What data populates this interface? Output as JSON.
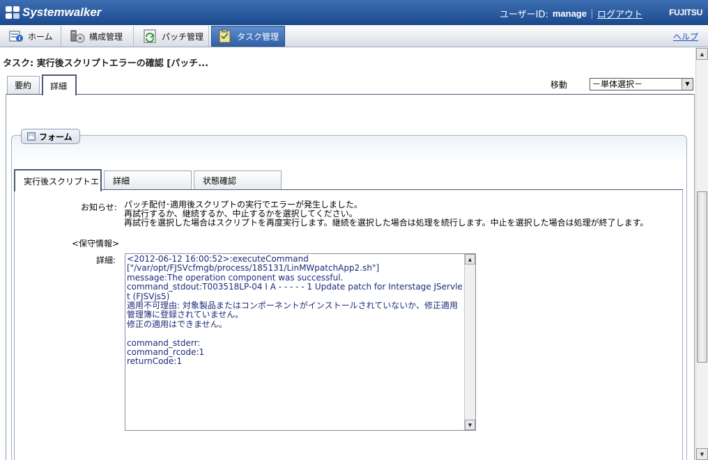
{
  "header": {
    "logo_text": "Systemwalker",
    "user_id_label": "ユーザーID:",
    "user_id_value": "manage",
    "logout_label": "ログアウト",
    "brand": "FUJITSU"
  },
  "nav": {
    "tabs": [
      {
        "label": "ホーム",
        "icon": "home-icon"
      },
      {
        "label": "構成管理",
        "icon": "configuration-icon"
      },
      {
        "label": "パッチ管理",
        "icon": "patch-icon"
      },
      {
        "label": "タスク管理",
        "icon": "task-icon",
        "active": true
      }
    ],
    "help_label": "ヘルプ"
  },
  "page": {
    "title": "タスク: 実行後スクリプトエラーの確認 [パッチ...",
    "tabs": [
      {
        "label": "要約"
      },
      {
        "label": "詳細",
        "active": true
      }
    ],
    "move_label": "移動",
    "move_select_value": "－単体選択－"
  },
  "form": {
    "legend": "フォーム",
    "tabs": [
      {
        "label": "実行後スクリプトエラ",
        "active": true
      },
      {
        "label": "詳細"
      },
      {
        "label": "状態確認"
      }
    ],
    "notice_label": "お知らせ:",
    "notice_lines": [
      "パッチ配付･適用後スクリプトの実行でエラーが発生しました。",
      "再試行するか、継続するか、中止するかを選択してください。",
      "再試行を選択した場合はスクリプトを再度実行します。継続を選択した場合は処理を続行します。中止を選択した場合は処理が終了します。"
    ],
    "maintenance_label": "<保守情報>",
    "detail_label": "詳細:",
    "detail_text": "<2012-06-12 16:00:52>:executeCommand\n[\"/var/opt/FJSVcfmgb/process/185131/LinMWpatchApp2.sh\"]\nmessage:The operation component was successful.\ncommand_stdout:T003518LP-04 I A - - - - - 1 Update patch for Interstage JServlet (FJSVjs5)\n適用不可理由: 対象製品またはコンポーネントがインストールされていないか、修正適用管理簿に登録されていません。\n修正の適用はできません。\n\ncommand_stderr:\ncommand_rcode:1\nreturnCode:1"
  },
  "colors": {
    "header_bg": "#2a5aa0",
    "active_tab_bg": "#3f72b8",
    "link": "#1c4fb3",
    "detail_text": "#1c2b7a"
  }
}
